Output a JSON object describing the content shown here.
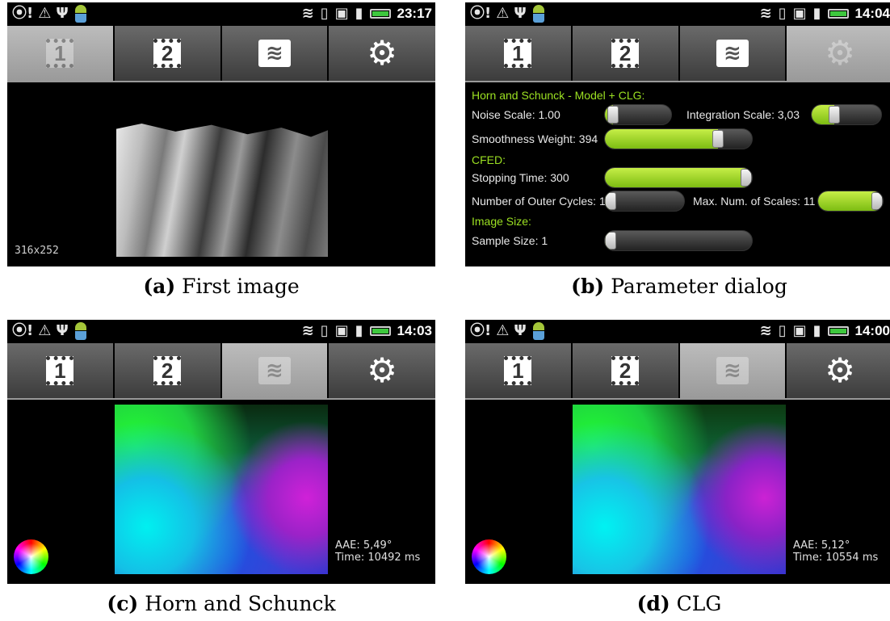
{
  "statusbar": {
    "icons": [
      "location-alert-icon",
      "warning-icon",
      "usb-icon",
      "android-icon",
      "wifi-icon",
      "vibrate-icon",
      "sd-card-icon",
      "signal-icon",
      "battery-icon"
    ],
    "accent_color": "#3ec83e"
  },
  "tabs": [
    {
      "label": "1",
      "icon": "film-frame-1-icon"
    },
    {
      "label": "2",
      "icon": "film-frame-2-icon"
    },
    {
      "label": "≋",
      "icon": "optical-flow-icon"
    },
    {
      "label": "⚙",
      "icon": "gear-icon"
    }
  ],
  "panels": {
    "a": {
      "time": "23:17",
      "active_tab": 0,
      "resolution": "316x252"
    },
    "b": {
      "time": "14:04",
      "active_tab": 3,
      "heading_model": "Horn and Schunck - Model + CLG:",
      "noise_scale": "Noise Scale: 1.00",
      "integration_scale": "Integration Scale: 3,03",
      "smoothness_weight": "Smoothness Weight: 394",
      "heading_cfed": "CFED:",
      "stopping_time": "Stopping Time: 300",
      "outer_cycles": "Number of Outer Cycles: 1",
      "max_scales": "Max. Num. of Scales: 11",
      "heading_image_size": "Image Size:",
      "sample_size": "Sample Size: 1",
      "slider_values": {
        "noise_scale": 0.12,
        "integration_scale": 0.33,
        "smoothness_weight": 0.77,
        "stopping_time": 0.98,
        "outer_cycles": 0.02,
        "max_scales": 0.97,
        "sample_size": 0.02
      },
      "heading_color": "#9be022"
    },
    "c": {
      "time": "14:03",
      "active_tab": 2,
      "aae": "AAE:  5,49°",
      "time_ms": "Time: 10492 ms"
    },
    "d": {
      "time": "14:00",
      "active_tab": 2,
      "aae": "AAE:  5,12°",
      "time_ms": "Time: 10554 ms"
    }
  },
  "captions": {
    "a": {
      "letter": "(a)",
      "text": " First image"
    },
    "b": {
      "letter": "(b)",
      "text": " Parameter dialog"
    },
    "c": {
      "letter": "(c)",
      "text": " Horn and Schunck"
    },
    "d": {
      "letter": "(d)",
      "text": " CLG"
    }
  }
}
